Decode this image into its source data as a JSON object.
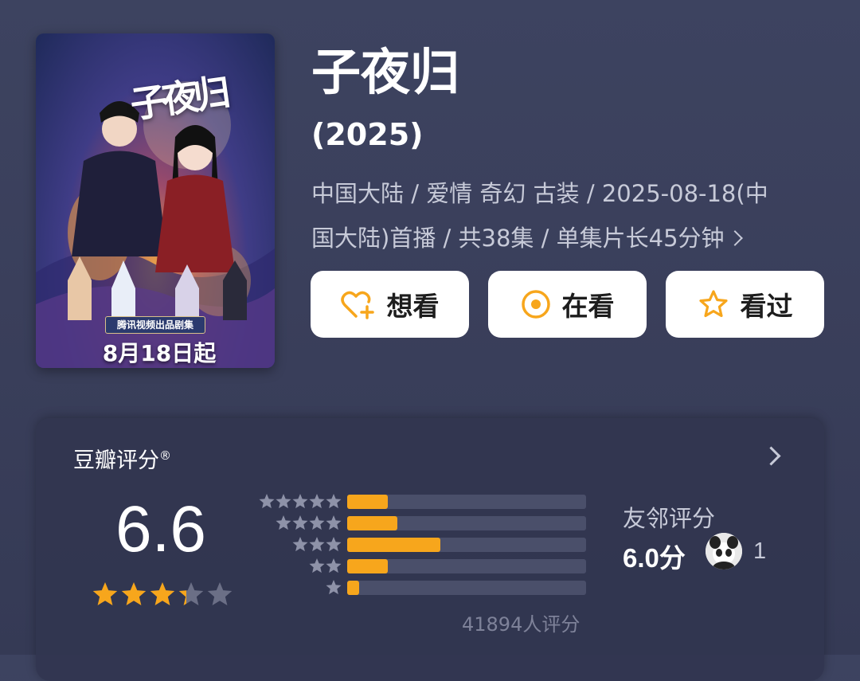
{
  "movie": {
    "title": "子夜归",
    "year": "(2025)",
    "meta_line1": "中国大陆 / 爱情 奇幻 古装 / 2025-08-18(中",
    "meta_line2": "国大陆)首播 / 共38集 / 单集片长45分钟"
  },
  "poster": {
    "logo_text": "子夜归",
    "tag": "腾讯视频出品剧集",
    "date": "8月18日起"
  },
  "actions": {
    "want": "想看",
    "watching": "在看",
    "watched": "看过"
  },
  "rating": {
    "label": "豆瓣评分",
    "mark": "®",
    "score": "6.6",
    "stars": 3.3,
    "count_text": "41894人评分",
    "distribution": [
      {
        "stars": 5,
        "fraction": 0.17
      },
      {
        "stars": 4,
        "fraction": 0.21
      },
      {
        "stars": 3,
        "fraction": 0.39
      },
      {
        "stars": 2,
        "fraction": 0.17
      },
      {
        "stars": 1,
        "fraction": 0.05
      }
    ],
    "friends": {
      "label": "友邻评分",
      "score": "6.0分",
      "count": "1"
    }
  },
  "colors": {
    "accent": "#f7a61c",
    "background": "#3b405c",
    "bar_track": "#4a4f6a"
  }
}
